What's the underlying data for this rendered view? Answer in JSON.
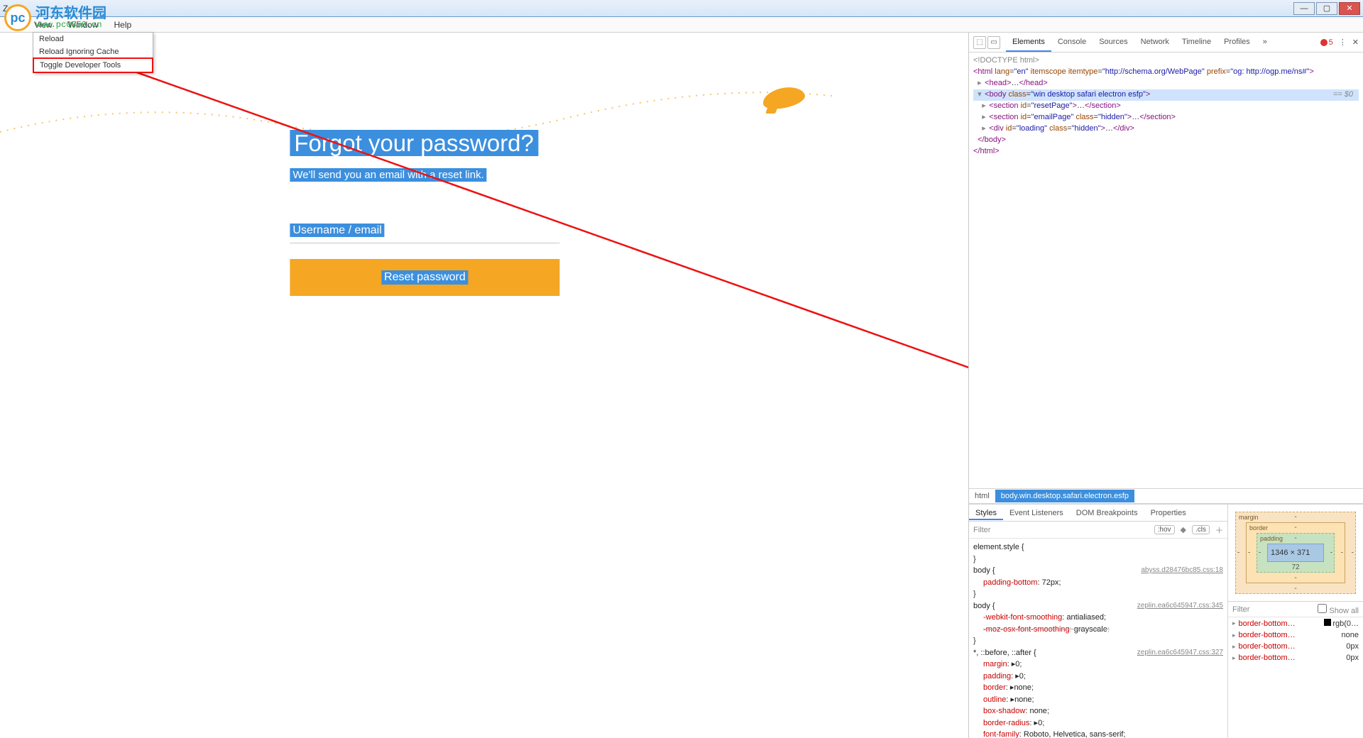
{
  "window": {
    "title": "Zeplin"
  },
  "menubar": {
    "items": [
      "View",
      "Window",
      "Help"
    ]
  },
  "dropdown": {
    "items": [
      "Reload",
      "Reload Ignoring Cache",
      "Toggle Developer Tools"
    ],
    "highlight_index": 2
  },
  "logo": {
    "badge": "pc",
    "cn": "河东软件园",
    "url": "www.pc0359.cn"
  },
  "reset": {
    "title": "Forgot your password?",
    "subtitle": "We'll send you an email with a reset link.",
    "field_label": "Username / email",
    "button": "Reset password"
  },
  "devtools": {
    "tabs": [
      "Elements",
      "Console",
      "Sources",
      "Network",
      "Timeline",
      "Profiles"
    ],
    "active_tab": "Elements",
    "error_count": "5",
    "dom": {
      "doctype": "<!DOCTYPE html>",
      "html_open": "<html lang=\"en\" itemscope itemtype=\"http://schema.org/WebPage\" prefix=\"og: http://ogp.me/ns#\">",
      "head": "<head>…</head>",
      "body_open": "<body class=\"win desktop safari electron esfp\">",
      "eq": "== $0",
      "section1": "<section id=\"resetPage\">…</section>",
      "section2": "<section id=\"emailPage\" class=\"hidden\">…</section>",
      "div1": "<div id=\"loading\" class=\"hidden\">…</div>",
      "body_close": "</body>",
      "html_close": "</html>"
    },
    "crumbs": {
      "first": "html",
      "second": "body.win.desktop.safari.electron.esfp"
    },
    "sub_tabs": [
      "Styles",
      "Event Listeners",
      "DOM Breakpoints",
      "Properties"
    ],
    "filter": {
      "label": "Filter",
      "hov": ":hov",
      "cls": ".cls"
    },
    "rules": [
      {
        "selector": "element.style {",
        "src": "",
        "decls": [],
        "close": "}"
      },
      {
        "selector": "body {",
        "src": "abyss.d28476bc85.css:18",
        "decls": [
          {
            "prop": "padding-bottom",
            "val": "72px"
          }
        ],
        "close": "}"
      },
      {
        "selector": "body {",
        "src": "zeplin.ea6c645947.css:345",
        "decls": [
          {
            "prop": "-webkit-font-smoothing",
            "val": "antialiased"
          },
          {
            "prop": "-moz-osx-font-smoothing",
            "val": "grayscale",
            "struck": true
          }
        ],
        "close": "}"
      },
      {
        "selector": "*, ::before, ::after {",
        "src": "zeplin.ea6c645947.css:327",
        "decls": [
          {
            "prop": "margin",
            "val": "▸0"
          },
          {
            "prop": "padding",
            "val": "▸0"
          },
          {
            "prop": "border",
            "val": "▸none"
          },
          {
            "prop": "outline",
            "val": "▸none"
          },
          {
            "prop": "box-shadow",
            "val": "none"
          },
          {
            "prop": "border-radius",
            "val": "▸0"
          },
          {
            "prop": "font-family",
            "val": "Roboto, Helvetica, sans-serif"
          }
        ],
        "close": ""
      }
    ],
    "boxmodel": {
      "margin": "margin",
      "border": "border",
      "padding": "padding",
      "content": "1346 × 371",
      "m": {
        "t": "-",
        "r": "-",
        "b": "-",
        "l": "-"
      },
      "b": {
        "t": "-",
        "r": "-",
        "b": "-",
        "l": "-"
      },
      "p": {
        "t": "-",
        "r": "-",
        "b": "72",
        "l": "-"
      }
    },
    "computed": {
      "filter": "Filter",
      "showall": "Show all",
      "rows": [
        {
          "prop": "border-bottom…",
          "val": "rgb(0…",
          "swatch": true
        },
        {
          "prop": "border-bottom…",
          "val": "none"
        },
        {
          "prop": "border-bottom…",
          "val": "0px"
        },
        {
          "prop": "border-bottom…",
          "val": "0px"
        }
      ]
    }
  }
}
